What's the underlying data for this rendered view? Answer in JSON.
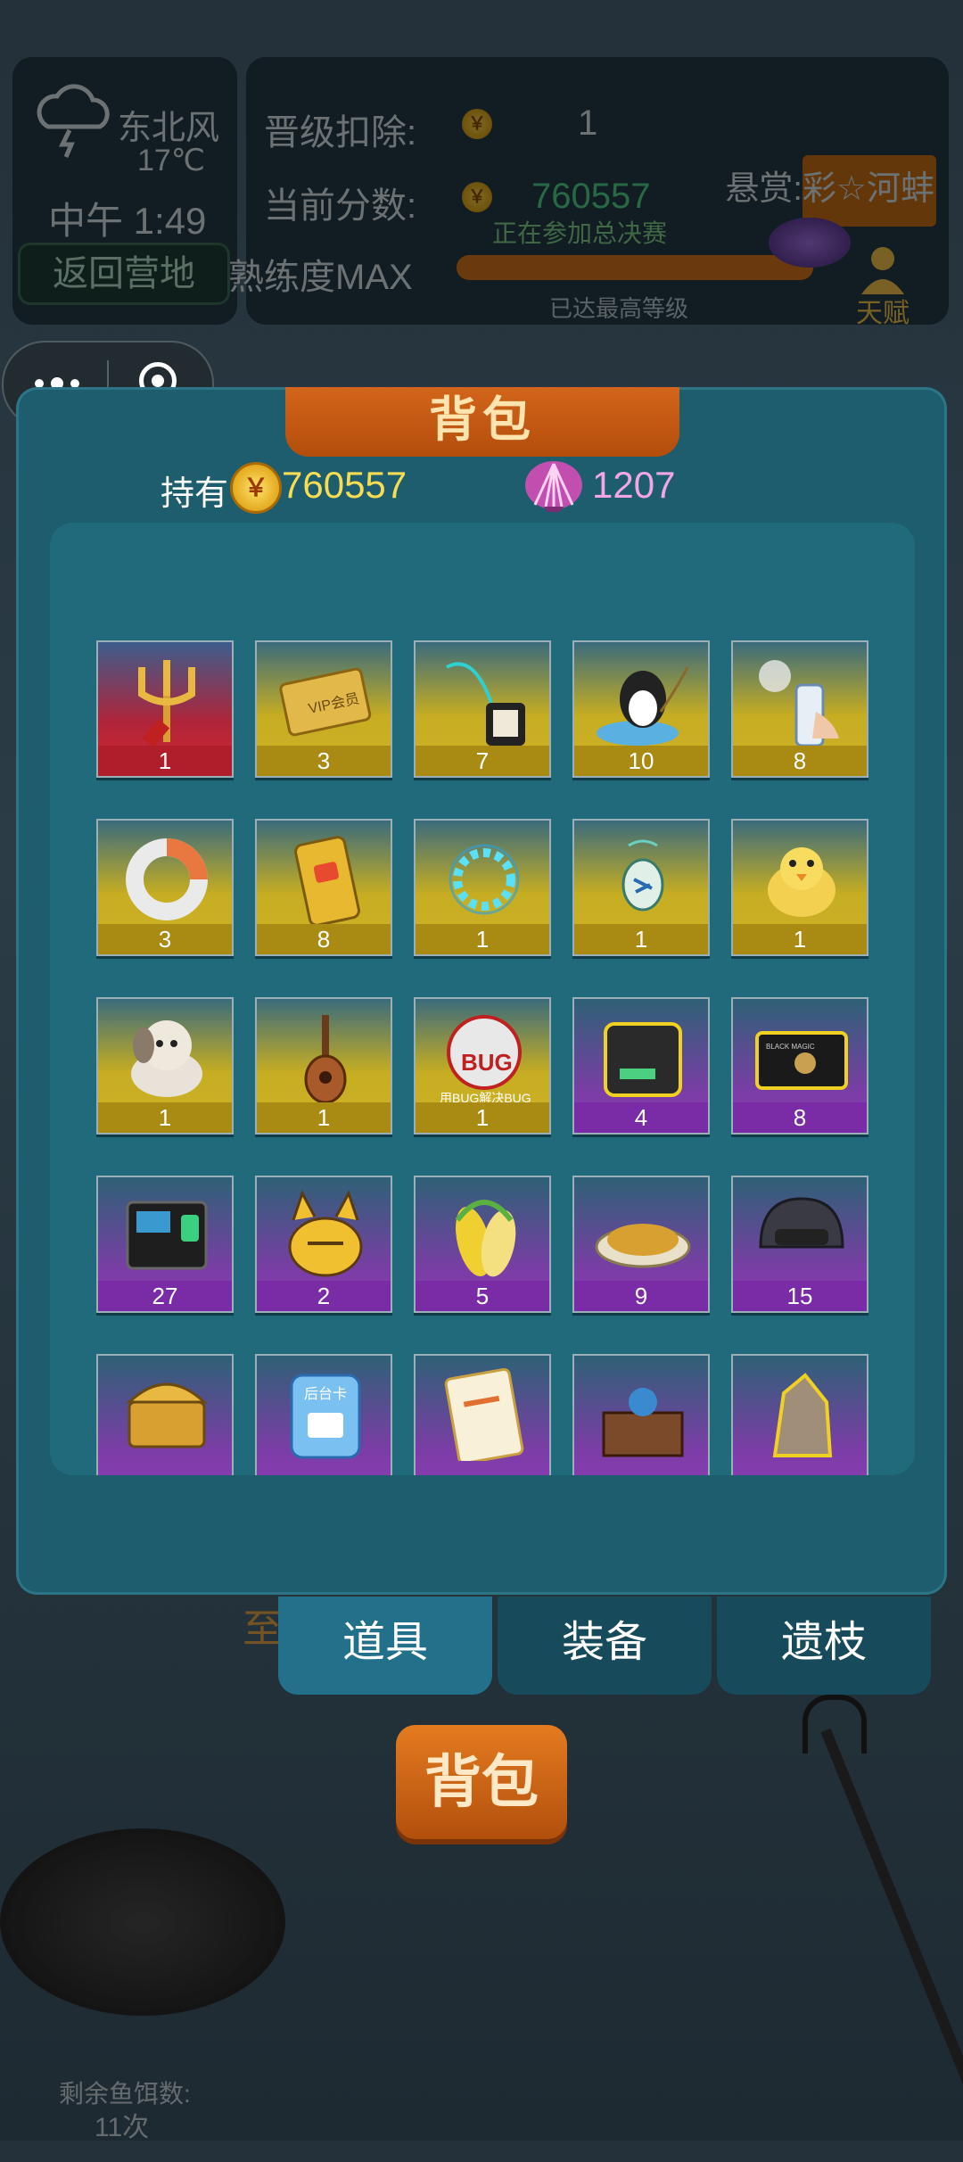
{
  "hud": {
    "wind": "东北风",
    "temperature": "17℃",
    "time": "中午 1:49",
    "back_button": "返回营地",
    "promo_deduct_label": "晋级扣除:",
    "promo_deduct_value": "1",
    "score_label": "当前分数:",
    "score_value": "760557",
    "finals_text": "正在参加总决赛",
    "mastery": "熟练度MAX",
    "max_level": "已达最高等级",
    "reward_label": "悬赏:彩☆河蚌",
    "thief_label": "天赋",
    "progress": 1.0
  },
  "background": {
    "caption": "至",
    "bait_label": "剩余鱼饵数:",
    "bait_count": "11次",
    "bag_button": "背包"
  },
  "panel": {
    "title": "背包",
    "held_label": "持有",
    "coin_glyph": "￥",
    "coins": "760557",
    "shells": "1207"
  },
  "items": [
    {
      "name": "trident",
      "count": "1",
      "rarity": "red"
    },
    {
      "name": "vip-card",
      "count": "3",
      "rarity": "gold"
    },
    {
      "name": "lanyard-badge",
      "count": "7",
      "rarity": "gold"
    },
    {
      "name": "penguin-fishing",
      "count": "10",
      "rarity": "gold"
    },
    {
      "name": "spray-can",
      "count": "8",
      "rarity": "gold"
    },
    {
      "name": "ring-donut",
      "count": "3",
      "rarity": "gold"
    },
    {
      "name": "video-phone-card",
      "count": "8",
      "rarity": "gold"
    },
    {
      "name": "blue-ring",
      "count": "1",
      "rarity": "gold"
    },
    {
      "name": "pendant",
      "count": "1",
      "rarity": "gold"
    },
    {
      "name": "yellow-duck",
      "count": "1",
      "rarity": "gold"
    },
    {
      "name": "puppy",
      "count": "1",
      "rarity": "gold"
    },
    {
      "name": "ukulele",
      "count": "1",
      "rarity": "gold"
    },
    {
      "name": "bug-badge",
      "count": "1",
      "rarity": "gold",
      "label": "BUG",
      "sublabel": "用BUG解决BUG"
    },
    {
      "name": "router-device",
      "count": "4",
      "rarity": "purple"
    },
    {
      "name": "black-card",
      "count": "8",
      "rarity": "purple",
      "label": "BLACK MAGIC"
    },
    {
      "name": "attendance-machine",
      "count": "27",
      "rarity": "purple"
    },
    {
      "name": "pikachu-cat",
      "count": "2",
      "rarity": "purple"
    },
    {
      "name": "corn",
      "count": "5",
      "rarity": "purple"
    },
    {
      "name": "grain-plate",
      "count": "9",
      "rarity": "purple"
    },
    {
      "name": "helmet",
      "count": "15",
      "rarity": "purple"
    },
    {
      "name": "treasure-chest",
      "count": "",
      "rarity": "purple"
    },
    {
      "name": "backstage-card",
      "count": "",
      "rarity": "purple",
      "label": "后台卡"
    },
    {
      "name": "clipboard-list",
      "count": "",
      "rarity": "purple"
    },
    {
      "name": "crystal-box",
      "count": "",
      "rarity": "purple"
    },
    {
      "name": "rock",
      "count": "",
      "rarity": "purple"
    }
  ],
  "tabs": [
    "道具",
    "装备",
    "遗枝"
  ],
  "colors": {
    "panel": "#1d5d6e",
    "title_bar": "#c85a14",
    "coin_text": "#f8dc52",
    "shell_text": "#f3a6e4"
  }
}
